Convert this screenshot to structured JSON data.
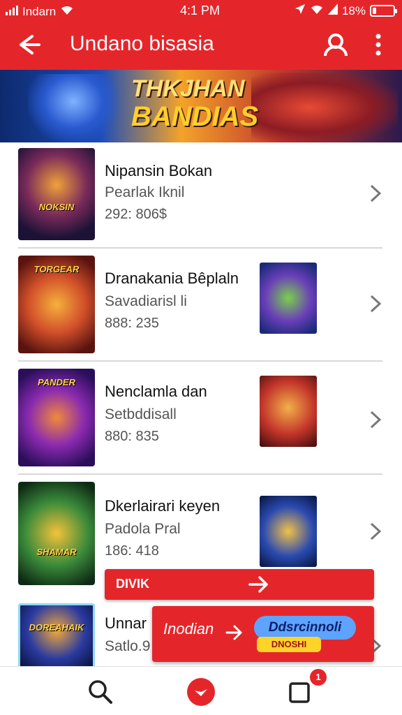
{
  "status_bar": {
    "carrier": "Indarn",
    "time": "4:1 PM",
    "battery": "18%",
    "battery_level": 0.18
  },
  "app_bar": {
    "title": "Undano bisasia"
  },
  "banner": {
    "title_line1": "THKJHAN",
    "title_line2": "BANDIAS"
  },
  "items": [
    {
      "title": "Nipansin Bokan",
      "subtitle": "Pearlak Iknil",
      "meta": "292: 806$",
      "thumb_caption": "NOKSIN"
    },
    {
      "title": "Dranakania Bêplaln",
      "subtitle": "Savadiarisl li",
      "meta": "888: 235",
      "thumb_caption": "TORGEAR"
    },
    {
      "title": "Nenclamla dan",
      "subtitle": "Setbddisall",
      "meta": "880: 835",
      "thumb_caption": "PANDER"
    },
    {
      "title": "Dkerlairari keyen",
      "subtitle": "Padola Pral",
      "meta": "186: 418",
      "thumb_caption": "SHAMAR"
    },
    {
      "title": "Unnar",
      "subtitle": "Satlo.9",
      "meta": "",
      "thumb_caption": "DOREAHAIK"
    }
  ],
  "overlay_cta": {
    "label": "DIVIK"
  },
  "overlay_banner": {
    "label": "Inodian",
    "pill": "Ddsrcinnoli",
    "pill2": "DNOSHI"
  },
  "bottom_nav": {
    "badge_count": "1"
  },
  "colors": {
    "brand_red": "#e4262b",
    "text_primary": "#111111",
    "text_secondary": "#555555",
    "divider": "#d8d8d8"
  }
}
